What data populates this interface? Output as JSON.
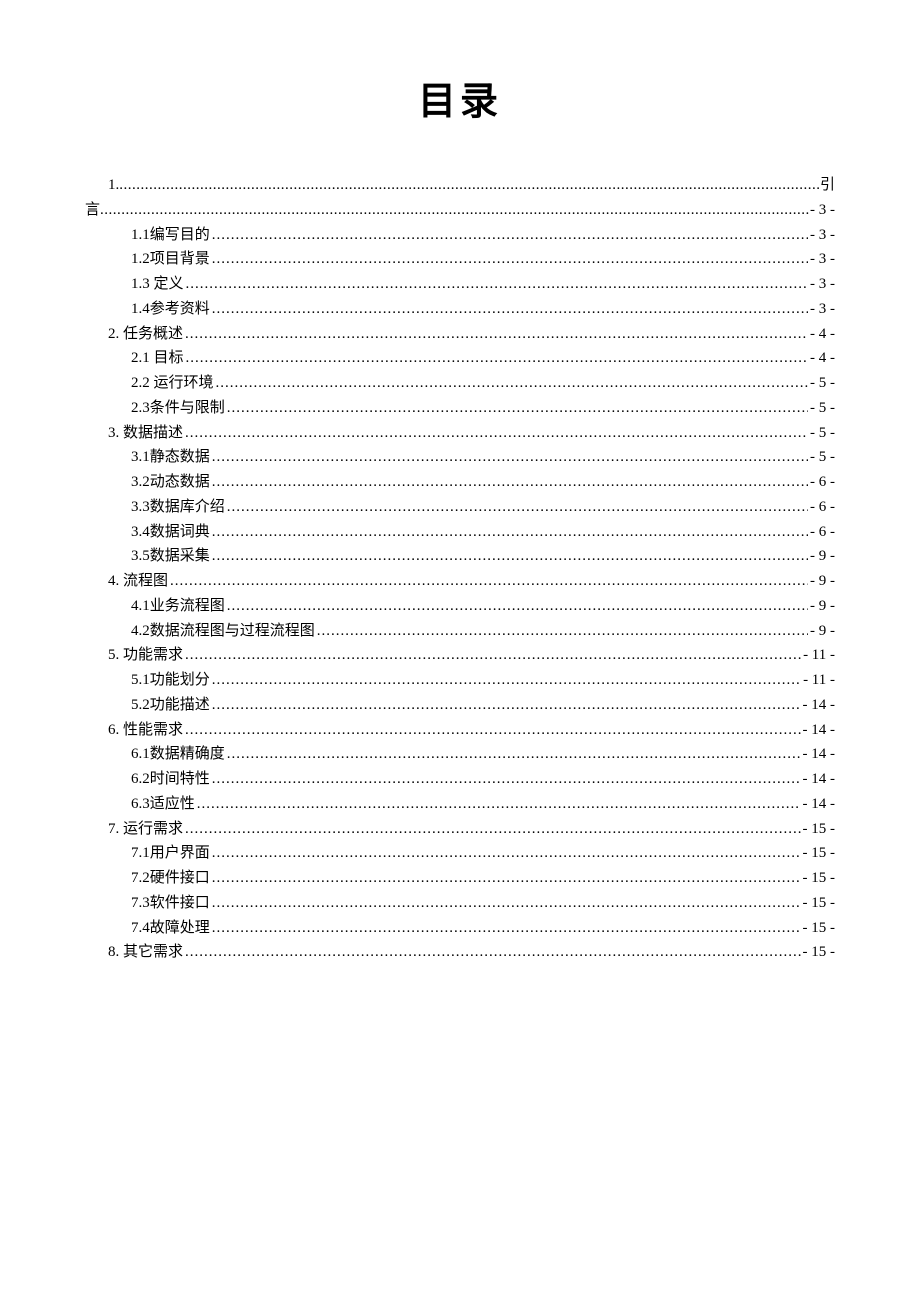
{
  "title": "目录",
  "toc": {
    "line1_left": "1.",
    "line1_right": "引",
    "line2_left": "言",
    "line2_right": "- 3 -",
    "items": [
      {
        "indent": 2,
        "label": "1.1编写目的",
        "page": "- 3 -"
      },
      {
        "indent": 2,
        "label": "1.2项目背景",
        "page": "- 3 -"
      },
      {
        "indent": 2,
        "label": "1.3 定义",
        "page": "- 3 -"
      },
      {
        "indent": 2,
        "label": "1.4参考资料",
        "page": "- 3 -"
      },
      {
        "indent": 1,
        "label": "2.  任务概述",
        "page": "- 4 -"
      },
      {
        "indent": 2,
        "label": "2.1 目标",
        "page": "- 4 -"
      },
      {
        "indent": 2,
        "label": "2.2  运行环境",
        "page": "- 5 -"
      },
      {
        "indent": 2,
        "label": "2.3条件与限制",
        "page": "- 5 -"
      },
      {
        "indent": 1,
        "label": "3.  数据描述",
        "page": "- 5 -"
      },
      {
        "indent": 2,
        "label": "3.1静态数据",
        "page": "- 5 -"
      },
      {
        "indent": 2,
        "label": "3.2动态数据",
        "page": "- 6 -"
      },
      {
        "indent": 2,
        "label": "3.3数据库介绍",
        "page": "- 6 -"
      },
      {
        "indent": 2,
        "label": "3.4数据词典",
        "page": "- 6 -"
      },
      {
        "indent": 2,
        "label": "3.5数据采集",
        "page": "- 9 -"
      },
      {
        "indent": 1,
        "label": "4.  流程图",
        "page": "- 9 -"
      },
      {
        "indent": 2,
        "label": "4.1业务流程图",
        "page": "- 9 -"
      },
      {
        "indent": 2,
        "label": "4.2数据流程图与过程流程图",
        "page": "- 9 -"
      },
      {
        "indent": 1,
        "label": "5.  功能需求",
        "page": "- 11 -"
      },
      {
        "indent": 2,
        "label": "5.1功能划分",
        "page": "- 11 -"
      },
      {
        "indent": 2,
        "label": "5.2功能描述",
        "page": "- 14 -"
      },
      {
        "indent": 1,
        "label": "6.  性能需求",
        "page": "- 14 -"
      },
      {
        "indent": 2,
        "label": "6.1数据精确度",
        "page": "- 14 -"
      },
      {
        "indent": 2,
        "label": "6.2时间特性",
        "page": "- 14 -"
      },
      {
        "indent": 2,
        "label": "6.3适应性",
        "page": "- 14 -"
      },
      {
        "indent": 1,
        "label": "7.  运行需求",
        "page": "- 15 -"
      },
      {
        "indent": 2,
        "label": "7.1用户界面",
        "page": "- 15 -"
      },
      {
        "indent": 2,
        "label": "7.2硬件接口",
        "page": "- 15 -"
      },
      {
        "indent": 2,
        "label": "7.3软件接口",
        "page": "- 15 -"
      },
      {
        "indent": 2,
        "label": "7.4故障处理",
        "page": "- 15 -"
      },
      {
        "indent": 1,
        "label": "8.  其它需求",
        "page": "- 15 -"
      }
    ]
  }
}
